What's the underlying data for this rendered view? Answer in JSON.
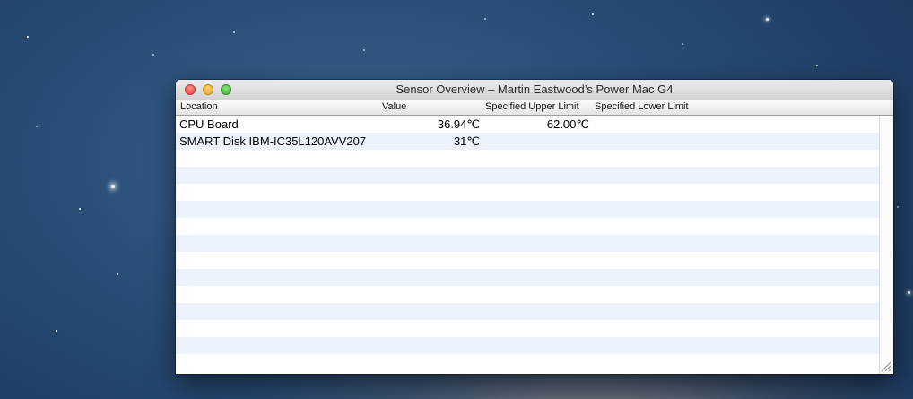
{
  "window": {
    "title": "Sensor Overview – Martin Eastwood’s Power Mac G4"
  },
  "table": {
    "columns": [
      "Location",
      "Value",
      "Specified Upper Limit",
      "Specified Lower Limit"
    ],
    "rows": [
      {
        "location": "CPU Board",
        "value": "36.94℃",
        "upper": "62.00℃",
        "lower": ""
      },
      {
        "location": "SMART Disk IBM-IC35L120AVV207",
        "value": "31℃",
        "upper": "",
        "lower": ""
      }
    ],
    "empty_rows": 13
  },
  "colors": {
    "stripe": "#edf3fe",
    "close": "#e0443c",
    "minimize": "#e1a228",
    "zoom": "#3fae2f"
  }
}
